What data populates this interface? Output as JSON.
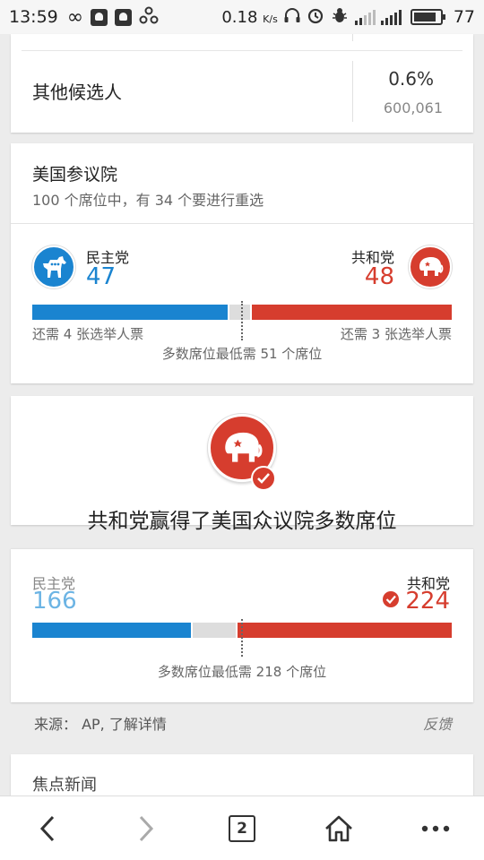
{
  "status_bar": {
    "time": "13:59",
    "speed": "0.18",
    "speed_unit": "K/s",
    "network": "4G",
    "battery": "77"
  },
  "other_candidates": {
    "name": "其他候选人",
    "percent": "0.6%",
    "votes": "600,061"
  },
  "senate": {
    "title": "美国参议院",
    "subtitle": "100 个席位中，有 34 个要进行重选",
    "dem_label": "民主党",
    "dem_seats": "47",
    "rep_label": "共和党",
    "rep_seats": "48",
    "dem_need": "还需 4 张选举人票",
    "rep_need": "还需 3 张选举人票",
    "majority": "多数席位最低需 51 个席位",
    "total_seats": 100,
    "dem_value": 47,
    "rep_value": 48
  },
  "house": {
    "winner_title": "共和党赢得了美国众议院多数席位",
    "dem_label": "民主党",
    "dem_seats": "166",
    "rep_label": "共和党",
    "rep_seats": "224",
    "majority": "多数席位最低需 218 个席位",
    "total_seats": 435,
    "dem_value": 166,
    "rep_value": 224
  },
  "footer": {
    "source": "来源： AP, 了解详情",
    "feedback": "反馈"
  },
  "news": {
    "title": "焦点新闻"
  },
  "bottom_nav": {
    "tab_count": "2"
  },
  "colors": {
    "democrat": "#1a84d0",
    "republican": "#d63d2e",
    "neutral": "#dddddd"
  }
}
